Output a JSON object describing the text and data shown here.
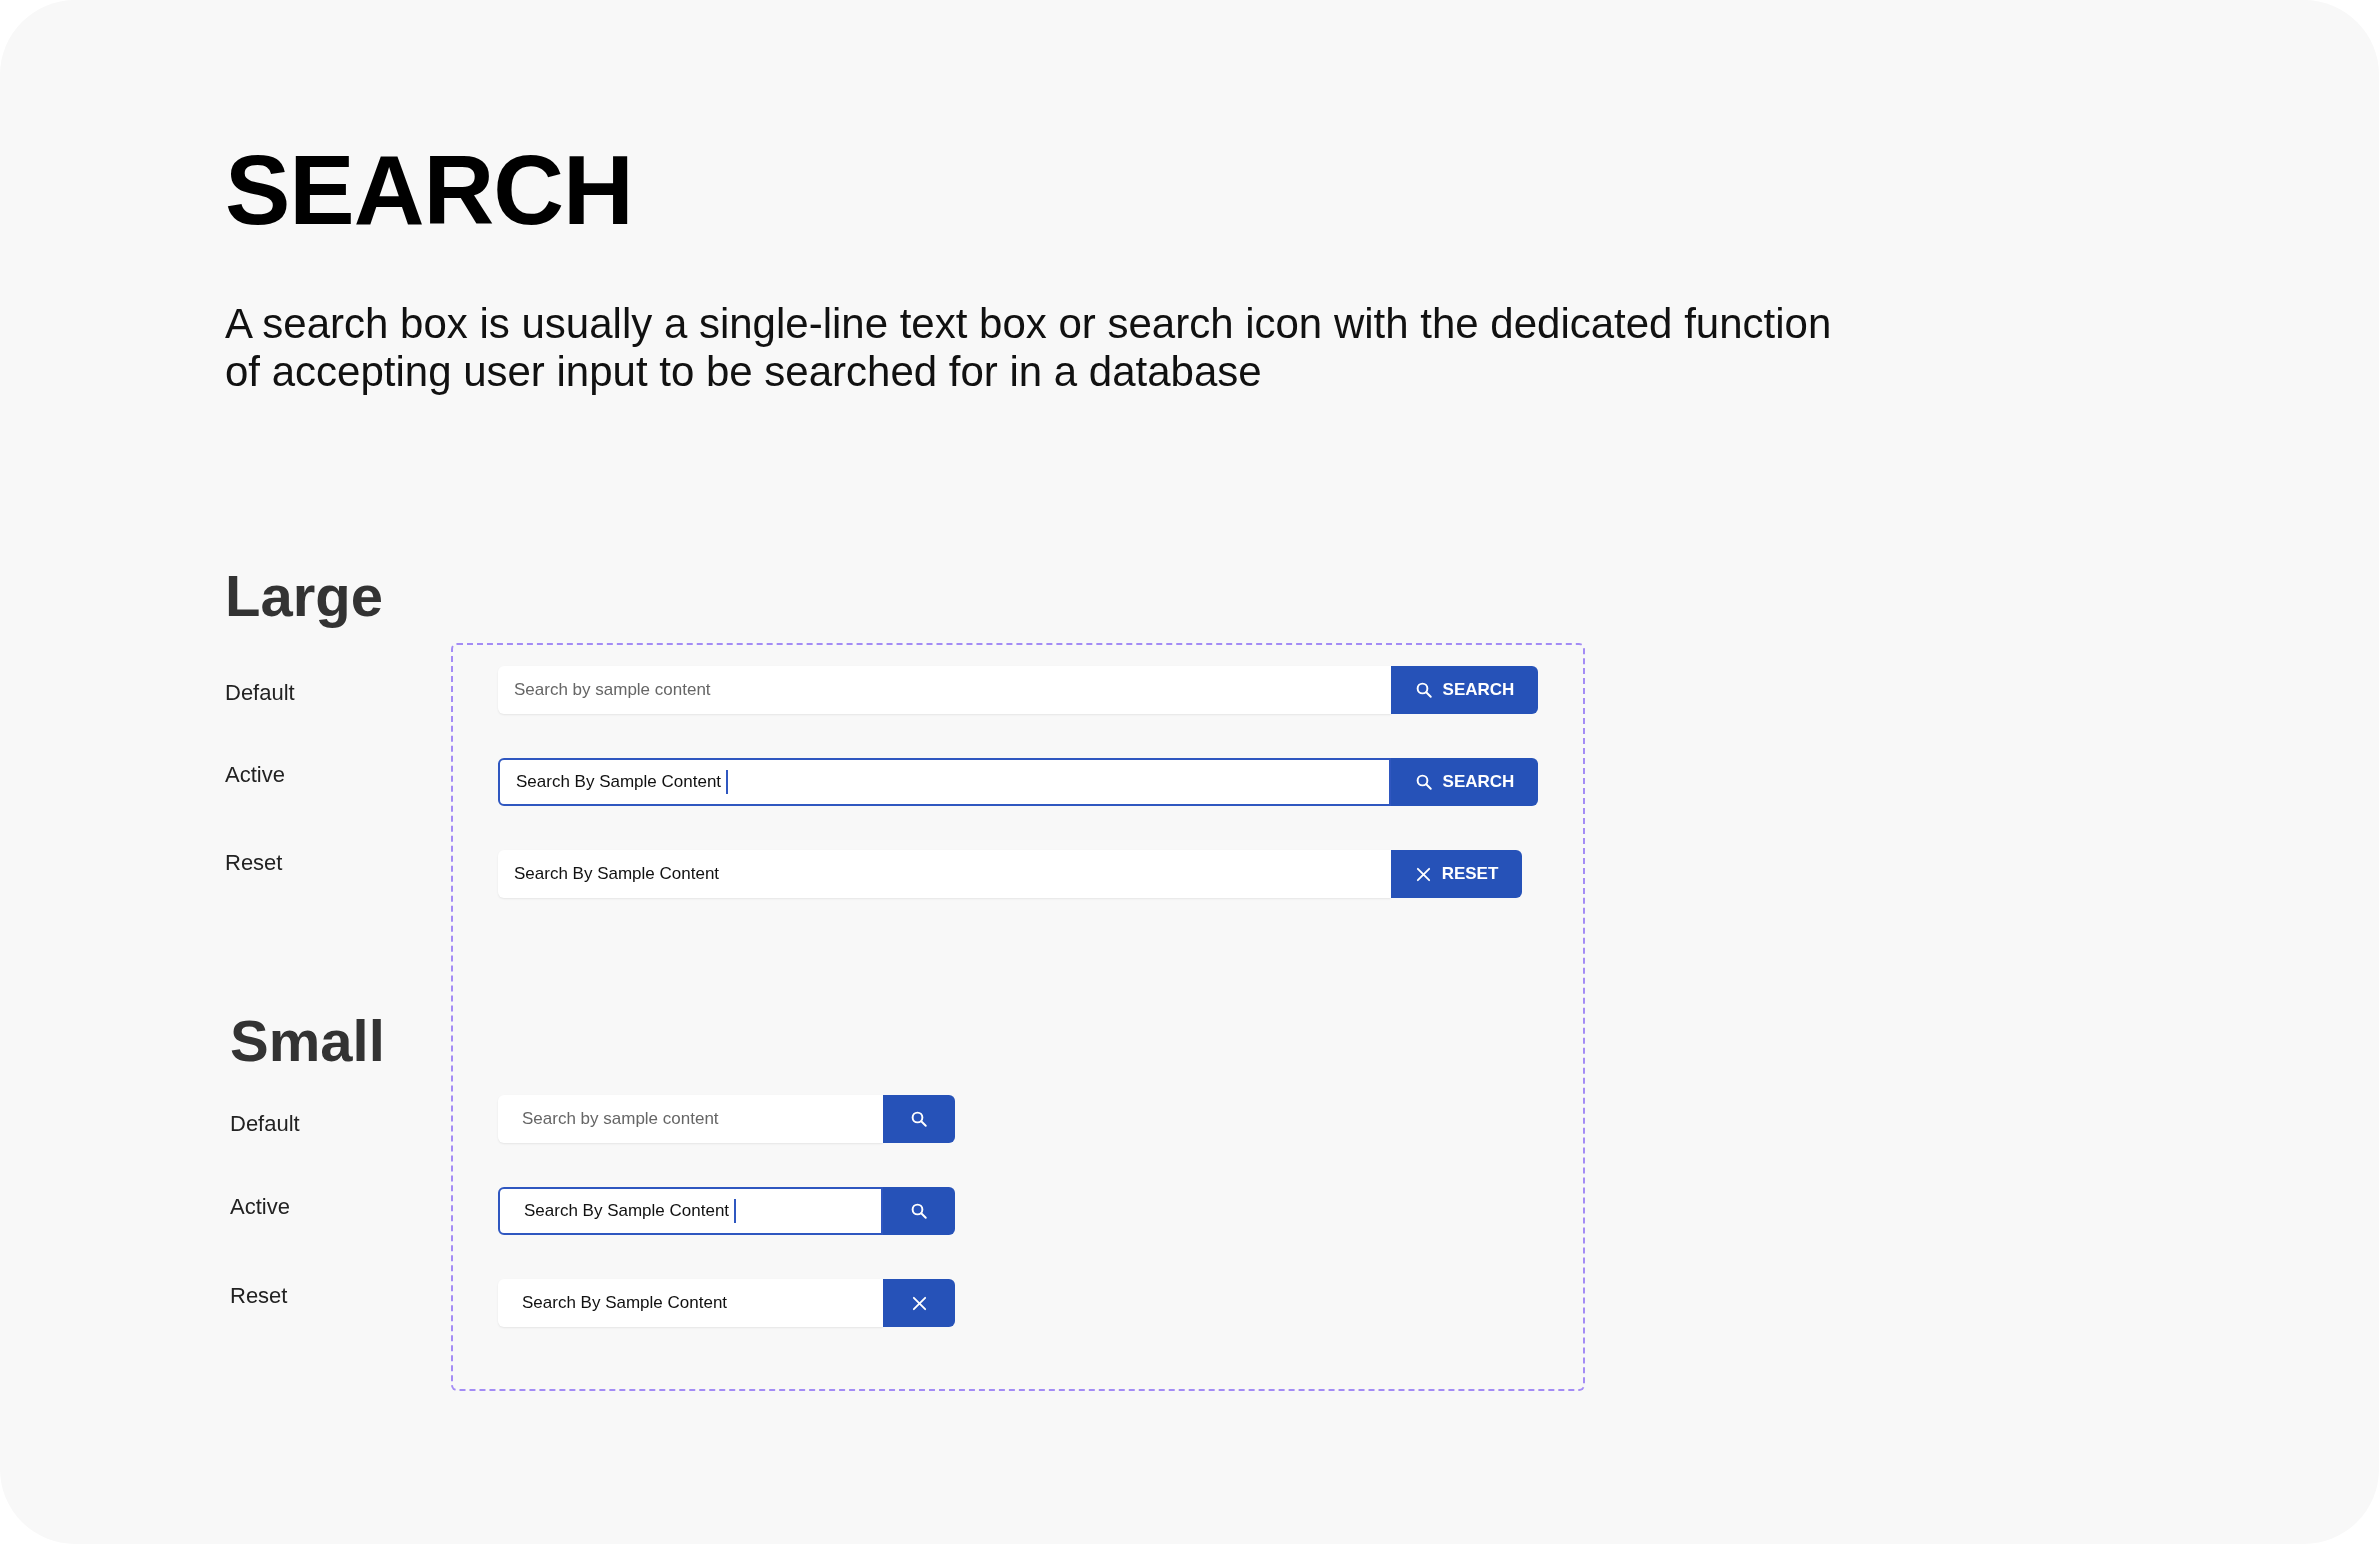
{
  "title": "SEARCH",
  "description": "A search box is usually a single-line text box or search icon with the dedicated function of accepting user input to be searched for in a database",
  "sections": [
    {
      "heading": "Large",
      "kind": "large",
      "rows": [
        {
          "label": "Default",
          "kind": "default",
          "placeholder": "Search by sample content",
          "button": "SEARCH"
        },
        {
          "label": "Active",
          "kind": "active",
          "value": "Search By Sample Content",
          "button": "SEARCH"
        },
        {
          "label": "Reset",
          "kind": "reset",
          "value": "Search By Sample Content",
          "button": "RESET"
        }
      ]
    },
    {
      "heading": "Small",
      "kind": "small",
      "rows": [
        {
          "label": "Default",
          "kind": "default",
          "placeholder": "Search by sample content"
        },
        {
          "label": "Active",
          "kind": "active",
          "value": "Search By Sample Content"
        },
        {
          "label": "Reset",
          "kind": "reset",
          "value": "Search By Sample Content"
        }
      ]
    }
  ]
}
